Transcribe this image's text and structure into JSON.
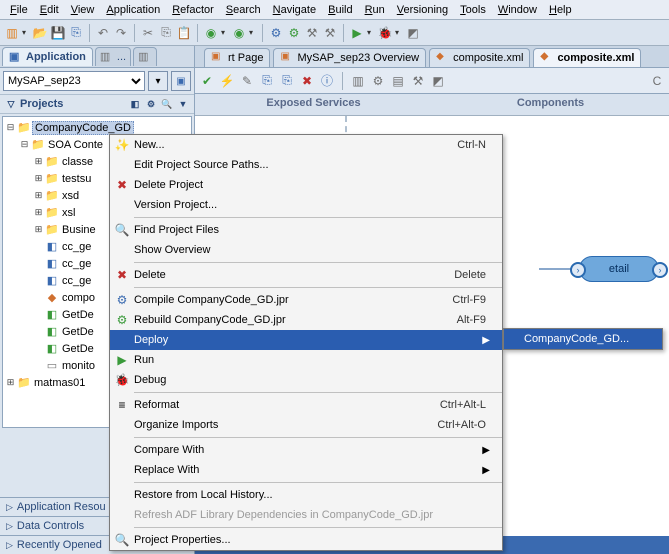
{
  "menu": [
    "File",
    "Edit",
    "View",
    "Application",
    "Refactor",
    "Search",
    "Navigate",
    "Build",
    "Run",
    "Versioning",
    "Tools",
    "Window",
    "Help"
  ],
  "left": {
    "app_tab": "Application",
    "project_selector": "MySAP_sep23",
    "projects_label": "Projects",
    "tree": [
      {
        "ind": 0,
        "tw": "⊟",
        "ic": "📁",
        "cls": "folder",
        "lbl": "CompanyCode_GD",
        "sel": true
      },
      {
        "ind": 1,
        "tw": "⊟",
        "ic": "📁",
        "cls": "folder",
        "lbl": "SOA Conte"
      },
      {
        "ind": 2,
        "tw": "⊞",
        "ic": "📁",
        "cls": "folder",
        "lbl": "classe"
      },
      {
        "ind": 2,
        "tw": "⊞",
        "ic": "📁",
        "cls": "folder",
        "lbl": "testsu"
      },
      {
        "ind": 2,
        "tw": "⊞",
        "ic": "📁",
        "cls": "folder",
        "lbl": "xsd"
      },
      {
        "ind": 2,
        "tw": "⊞",
        "ic": "📁",
        "cls": "folder",
        "lbl": "xsl"
      },
      {
        "ind": 2,
        "tw": "⊞",
        "ic": "📁",
        "cls": "folder",
        "lbl": "Busine"
      },
      {
        "ind": 2,
        "tw": "",
        "ic": "◧",
        "cls": "blue",
        "lbl": "cc_ge"
      },
      {
        "ind": 2,
        "tw": "",
        "ic": "◧",
        "cls": "blue",
        "lbl": "cc_ge"
      },
      {
        "ind": 2,
        "tw": "",
        "ic": "◧",
        "cls": "blue",
        "lbl": "cc_ge"
      },
      {
        "ind": 2,
        "tw": "",
        "ic": "◆",
        "cls": "xml",
        "lbl": "compo"
      },
      {
        "ind": 2,
        "tw": "",
        "ic": "◧",
        "cls": "green",
        "lbl": "GetDe"
      },
      {
        "ind": 2,
        "tw": "",
        "ic": "◧",
        "cls": "green",
        "lbl": "GetDe"
      },
      {
        "ind": 2,
        "tw": "",
        "ic": "◧",
        "cls": "green",
        "lbl": "GetDe"
      },
      {
        "ind": 2,
        "tw": "",
        "ic": "▭",
        "cls": "gray",
        "lbl": "monito"
      },
      {
        "ind": 0,
        "tw": "⊞",
        "ic": "📁",
        "cls": "folder",
        "lbl": "matmas01"
      }
    ],
    "sec_app_res": "Application Resou",
    "sec_data_ctrl": "Data Controls",
    "sec_recent": "Recently Opened"
  },
  "tabs": [
    {
      "ic": "▣",
      "lbl": "rt Page"
    },
    {
      "ic": "▣",
      "lbl": "MySAP_sep23 Overview"
    },
    {
      "ic": "◆",
      "lbl": "composite.xml"
    },
    {
      "ic": "◆",
      "lbl": "composite.xml",
      "active": true
    }
  ],
  "canvas": {
    "exposed": "Exposed Services",
    "components": "Components",
    "node": "etail"
  },
  "ctx": [
    {
      "ic": "✨",
      "lbl": "New...",
      "sc": "Ctrl-N"
    },
    {
      "lbl": "Edit Project Source Paths..."
    },
    {
      "ic": "✖",
      "cls": "red",
      "lbl": "Delete Project"
    },
    {
      "lbl": "Version Project..."
    },
    {
      "sep": true
    },
    {
      "ic": "🔍",
      "cls": "blue",
      "lbl": "Find Project Files"
    },
    {
      "lbl": "Show Overview"
    },
    {
      "sep": true
    },
    {
      "ic": "✖",
      "cls": "red",
      "lbl": "Delete",
      "sc": "Delete"
    },
    {
      "sep": true
    },
    {
      "ic": "⚙",
      "cls": "blue",
      "lbl": "Compile CompanyCode_GD.jpr",
      "sc": "Ctrl-F9"
    },
    {
      "ic": "⚙",
      "cls": "green",
      "lbl": "Rebuild CompanyCode_GD.jpr",
      "sc": "Alt-F9"
    },
    {
      "lbl": "Deploy",
      "arr": true,
      "hl": true
    },
    {
      "ic": "▶",
      "cls": "green",
      "lbl": "Run"
    },
    {
      "ic": "🐞",
      "cls": "red",
      "lbl": "Debug"
    },
    {
      "sep": true
    },
    {
      "ic": "≡",
      "lbl": "Reformat",
      "sc": "Ctrl+Alt-L"
    },
    {
      "lbl": "Organize Imports",
      "sc": "Ctrl+Alt-O"
    },
    {
      "sep": true
    },
    {
      "lbl": "Compare With",
      "arr": true
    },
    {
      "lbl": "Replace With",
      "arr": true
    },
    {
      "sep": true
    },
    {
      "lbl": "Restore from Local History..."
    },
    {
      "lbl": "Refresh ADF Library Dependencies in CompanyCode_GD.jpr",
      "dis": true
    },
    {
      "sep": true
    },
    {
      "ic": "🔍",
      "lbl": "Project Properties..."
    }
  ],
  "submenu_item": "CompanyCode_GD..."
}
